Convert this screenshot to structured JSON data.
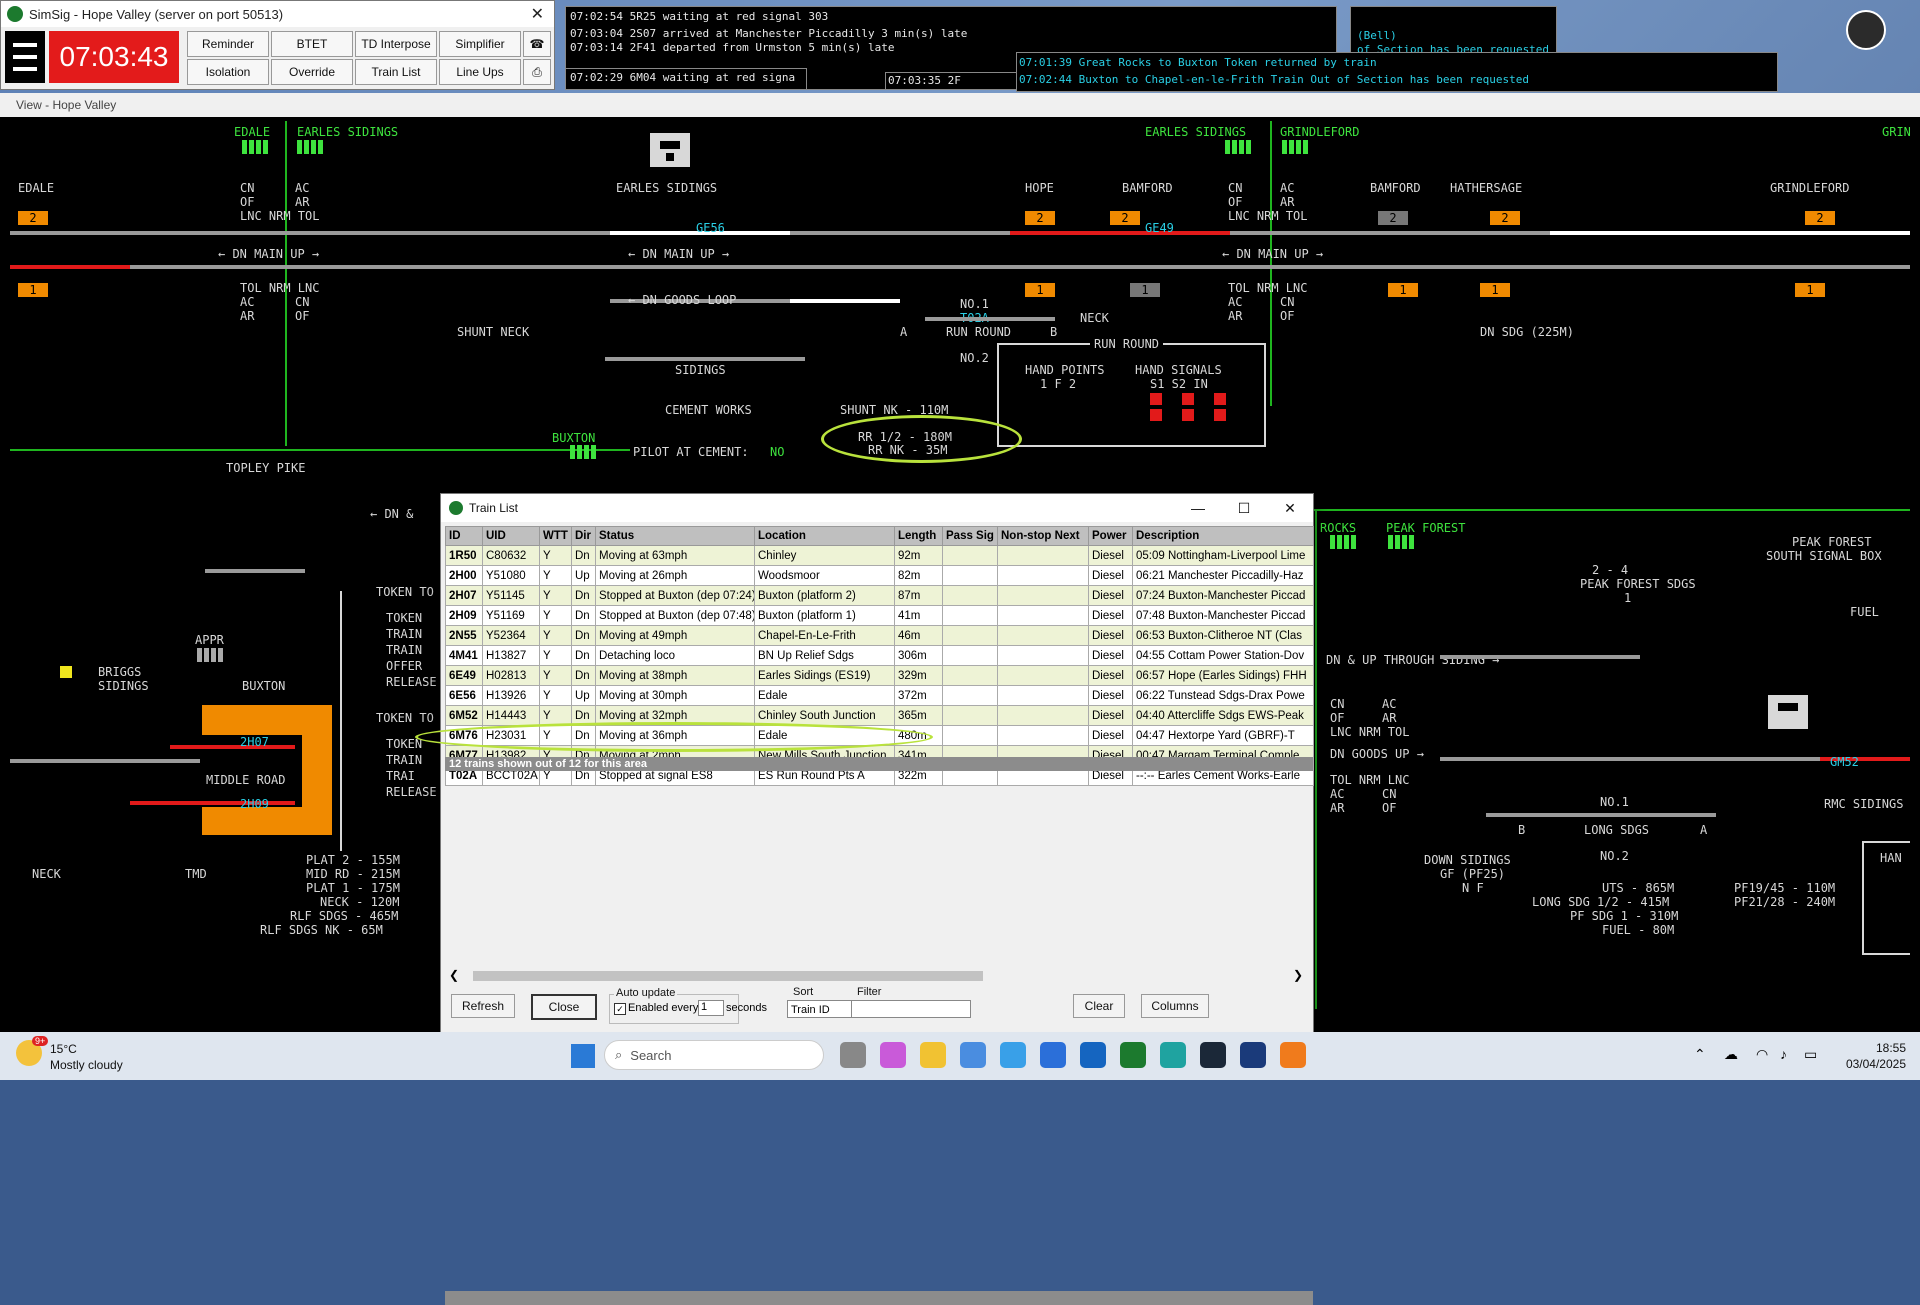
{
  "toolbar": {
    "title": "SimSig - Hope Valley (server on port 50513)",
    "clock": "07:03:43",
    "buttons": [
      "Reminder",
      "BTET",
      "TD Interpose",
      "Simplifier",
      "Isolation",
      "Override",
      "Train List",
      "Line Ups"
    ]
  },
  "messages": {
    "left": [
      "07:02:54 5R25 waiting at red signal 303",
      "07:03:04 2S07 arrived at Manchester Piccadilly 3 min(s) late",
      "07:03:14 2F41 departed from Urmston 5 min(s) late",
      "07:02:29 6M04 waiting at red signa"
    ],
    "bottom_stub": "07:03:35 2F",
    "bottom_stub2": "07:03:",
    "right": [
      "07:01:39 Great Rocks to Buxton Token returned by train",
      "07:02:44 Buxton to Chapel-en-le-Frith Train Out of Section has been requested"
    ],
    "behind": [
      "(Bell)",
      "of Section has been requested"
    ]
  },
  "view": {
    "title": "View - Hope Valley",
    "labels": {
      "edale": "EDALE",
      "earles_sidings": "EARLES SIDINGS",
      "earles_sidings_c": "EARLES SIDINGS",
      "grindleford": "GRINDLEFORD",
      "grin": "GRIN",
      "edale2": "EDALE",
      "hope": "HOPE",
      "bamford": "BAMFORD",
      "bamford2": "BAMFORD",
      "hathersage": "HATHERSAGE",
      "grindleford2": "GRINDLEFORD",
      "dn_main_up": "← DN MAIN UP →",
      "lnc_nrm_tol": "LNC NRM TOL",
      "tol_nrm_lnc": "TOL NRM LNC",
      "cn": "CN",
      "of": "OF",
      "ac": "AC",
      "ar": "AR",
      "dn_goods_loop": "← DN GOODS LOOP",
      "shunt_neck": "SHUNT NECK",
      "sidings": "SIDINGS",
      "no1": "NO.1",
      "run_round": "RUN ROUND",
      "no2": "NO.2",
      "neck": "NECK",
      "t02a": "T02A",
      "ge56": "GE56",
      "ge49": "GE49",
      "run_round_title": "RUN ROUND",
      "hand_points": "HAND POINTS",
      "hand_signals": "HAND SIGNALS",
      "hp_cols": "1  F  2",
      "hs_cols": "S1  S2  IN",
      "cement_works": "CEMENT WORKS",
      "shunt_nk": "SHUNT NK - 110M",
      "rr12": "RR 1/2 - 180M",
      "rrnk": "RR NK - 35M",
      "pilot_label": "PILOT AT CEMENT:",
      "pilot_value": "NO",
      "buxton": "BUXTON",
      "topley_pike": "TOPLEY PIKE",
      "dn_and": "← DN &",
      "token_to": "TOKEN TO",
      "token_to2": "TOKEN TO",
      "appr": "APPR",
      "briggs": "BRIGGS",
      "sidings2": "SIDINGS",
      "buxton2": "BUXTON",
      "token_list": [
        "TOKEN",
        "TRAIN",
        "TRAIN",
        "OFFER",
        "RELEASE"
      ],
      "token_list2": [
        "TOKEN",
        "TRAIN",
        "TRAI",
        "RELEASE"
      ],
      "middle_road": "MIDDLE ROAD",
      "neck2": "NECK",
      "tmd": "TMD",
      "train_2h07": "2H07",
      "train_2h09": "2H09",
      "plat_info": [
        "PLAT 2 - 155M",
        "MID RD - 215M",
        "PLAT 1 - 175M",
        "NECK - 120M",
        "RLF SDGS - 465M",
        "RLF SDGS NK - 65M"
      ],
      "rocks": "ROCKS",
      "peak_forest": "PEAK FOREST",
      "peak_forest_box": "PEAK FOREST",
      "south_signal_box": "SOUTH SIGNAL BOX",
      "pf_sdgs": "PEAK FOREST SDGS",
      "two_four": "2 - 4",
      "one": "1",
      "fuel": "FUEL",
      "dn_up_through": "DN & UP THROUGH SIDING →",
      "dn_goods_up": "DN GOODS UP →",
      "gm52": "GM52",
      "no1b": "NO.1",
      "long_sdgs": "LONG SDGS",
      "no2b": "NO.2",
      "rmc_sidings": "RMC SIDINGS",
      "down_sidings": "DOWN SIDINGS",
      "gf_pf25": "GF (PF25)",
      "nf": "N  F",
      "uts": "UTS - 865M",
      "long_sdg": "LONG SDG 1/2 - 415M",
      "pf_sdg1": "PF SDG 1 - 310M",
      "fuel_len": "FUEL - 80M",
      "pf1945": "PF19/45 - 110M",
      "pf2128": "PF21/28 - 240M",
      "dn_sdg": "DN SDG (225M)",
      "ha": "HAN",
      "b": "B",
      "a": "A"
    }
  },
  "train_list": {
    "title": "Train List",
    "columns": [
      "ID",
      "UID",
      "WTT",
      "Dir",
      "Status",
      "Location",
      "Length",
      "Pass Sig",
      "Non-stop Next",
      "Power",
      "Description"
    ],
    "rows": [
      [
        "1R50",
        "C80632",
        "Y",
        "Dn",
        "Moving at 63mph",
        "Chinley",
        "92m",
        "",
        "",
        "Diesel",
        "05:09 Nottingham-Liverpool Lime"
      ],
      [
        "2H00",
        "Y51080",
        "Y",
        "Up",
        "Moving at 26mph",
        "Woodsmoor",
        "82m",
        "",
        "",
        "Diesel",
        "06:21 Manchester Piccadilly-Haz"
      ],
      [
        "2H07",
        "Y51145",
        "Y",
        "Dn",
        "Stopped at Buxton (dep 07:24)",
        "Buxton (platform 2)",
        "87m",
        "",
        "",
        "Diesel",
        "07:24 Buxton-Manchester Piccad"
      ],
      [
        "2H09",
        "Y51169",
        "Y",
        "Dn",
        "Stopped at Buxton (dep 07:48)",
        "Buxton (platform 1)",
        "41m",
        "",
        "",
        "Diesel",
        "07:48 Buxton-Manchester Piccad"
      ],
      [
        "2N55",
        "Y52364",
        "Y",
        "Dn",
        "Moving at 49mph",
        "Chapel-En-Le-Frith",
        "46m",
        "",
        "",
        "Diesel",
        "06:53 Buxton-Clitheroe NT (Clas"
      ],
      [
        "4M41",
        "H13827",
        "Y",
        "Dn",
        "Detaching loco",
        "BN Up Relief Sdgs",
        "306m",
        "",
        "",
        "Diesel",
        "04:55 Cottam Power Station-Dov"
      ],
      [
        "6E49",
        "H02813",
        "Y",
        "Dn",
        "Moving at 38mph",
        "Earles Sidings (ES19)",
        "329m",
        "",
        "",
        "Diesel",
        "06:57 Hope (Earles Sidings) FHH"
      ],
      [
        "6E56",
        "H13926",
        "Y",
        "Up",
        "Moving at 30mph",
        "Edale",
        "372m",
        "",
        "",
        "Diesel",
        "06:22 Tunstead Sdgs-Drax Powe"
      ],
      [
        "6M52",
        "H14443",
        "Y",
        "Dn",
        "Moving at 32mph",
        "Chinley South Junction",
        "365m",
        "",
        "",
        "Diesel",
        "04:40 Attercliffe Sdgs EWS-Peak"
      ],
      [
        "6M76",
        "H23031",
        "Y",
        "Dn",
        "Moving at 36mph",
        "Edale",
        "480m",
        "",
        "",
        "Diesel",
        "04:47 Hextorpe Yard (GBRF)-T"
      ],
      [
        "6M77",
        "H13982",
        "Y",
        "Dn",
        "Moving at 2mph",
        "New Mills South Junction",
        "341m",
        "",
        "",
        "Diesel",
        "00:47 Margam Terminal Comple"
      ],
      [
        "T02A",
        "BCCT02A",
        "Y",
        "Dn",
        "Stopped at signal ES8",
        "ES Run Round Pts A",
        "322m",
        "",
        "",
        "Diesel",
        "--:-- Earles Cement Works-Earle"
      ]
    ],
    "summary": "12 trains shown out of 12 for this area",
    "buttons": {
      "refresh": "Refresh",
      "close": "Close",
      "clear": "Clear",
      "columns": "Columns"
    },
    "auto_update": {
      "group": "Auto update",
      "enabled_label": "Enabled every",
      "interval": "1",
      "unit": "seconds"
    },
    "sort": {
      "group": "Sort",
      "value": "Train ID"
    },
    "filter": {
      "group": "Filter",
      "value": ""
    }
  },
  "taskbar": {
    "temp": "15°C",
    "weather": "Mostly cloudy",
    "badge": "9+",
    "search_placeholder": "Search",
    "time": "18:55",
    "date": "03/04/2025"
  },
  "colors": {
    "alarm_red": "#e31b1b",
    "berth_orange": "#f08a00",
    "panel_green": "#3ee33e",
    "track_grey": "#9a9a9a",
    "highlight": "#b9e23c"
  }
}
